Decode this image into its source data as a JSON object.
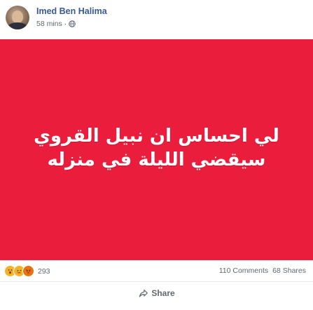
{
  "post": {
    "author": "Imed Ben Halima",
    "time": "58 mins",
    "separator": "·",
    "privacy_icon": "globe-icon",
    "banner": {
      "background": "#ea1d3d",
      "line1": "لي احساس ان نبيل القروي",
      "line2": "سيقضي الليلة في منزله"
    },
    "reactions": {
      "icons": [
        "wow-reaction-icon",
        "sad-reaction-icon",
        "angry-reaction-icon"
      ],
      "count": "293"
    },
    "comments_label": "110 Comments",
    "shares_label": "68 Shares",
    "share_button_label": "Share"
  }
}
